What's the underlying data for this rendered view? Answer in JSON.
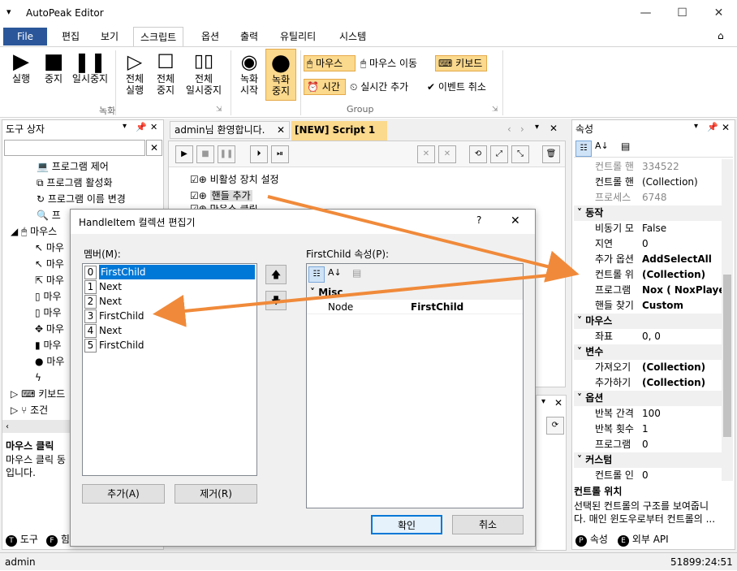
{
  "window": {
    "title": "AutoPeak Editor"
  },
  "menu": {
    "file": "File",
    "items": [
      "편집",
      "보기",
      "스크립트",
      "옵션",
      "출력",
      "유틸리티",
      "시스템"
    ]
  },
  "ribbon": {
    "run": "실행",
    "stop": "중지",
    "pause": "일시중지",
    "run_all_1": "전체",
    "run_all_2": "실행",
    "stop_all_1": "전체",
    "stop_all_2": "중지",
    "pause_all_1": "전체",
    "pause_all_2": "일시중지",
    "rec_start_1": "녹화",
    "rec_start_2": "시작",
    "rec_stop_1": "녹화",
    "rec_stop_2": "중지",
    "mouse": "마우스",
    "mouse_move": "마우스 이동",
    "keyboard": "키보드",
    "time": "시간",
    "realtime_add": "실시간 추가",
    "event_cancel": "이벤트 취소",
    "group_record": "녹화",
    "group_group": "Group"
  },
  "toolbox": {
    "title": "도구 상자",
    "items": [
      "프로그램 제어",
      "프로그램 활성화",
      "프로그램 이름 변경",
      "프",
      "마우스"
    ],
    "mouse_subs": [
      "마우",
      "마우",
      "마우",
      "마우",
      "마우",
      "마우",
      "마우",
      "마우"
    ],
    "keyboard": "키보드",
    "condition": "조건",
    "desc_title": "마우스 클릭",
    "desc_1": "마우스 클릭 동",
    "desc_2": "입니다.",
    "tab_tools": "도구",
    "tab_other": "힘"
  },
  "tabs": {
    "welcome": "admin님 환영합니다.",
    "script": "[NEW] Script 1"
  },
  "script_items": [
    "비활성 장치 설정",
    "핸들 추가",
    "마우스 클릭"
  ],
  "properties": {
    "title": "속성",
    "rows": [
      {
        "k": "컨트롤 핸",
        "v": "334522",
        "dim": true
      },
      {
        "k": "컨트롤 핸",
        "v": "(Collection)"
      },
      {
        "k": "프로세스",
        "v": "6748",
        "dim": true
      }
    ],
    "cat_action": "동작",
    "action_rows": [
      {
        "k": "비동기 모",
        "v": "False"
      },
      {
        "k": "지연",
        "v": "0"
      },
      {
        "k": "추가 옵션",
        "v": "AddSelectAll",
        "bold": true
      },
      {
        "k": "컨트롤 위",
        "v": "(Collection)",
        "bold": true
      },
      {
        "k": "프로그램",
        "v": "Nox ( NoxPlayer",
        "bold": true
      },
      {
        "k": "핸들 찾기",
        "v": "Custom",
        "bold": true
      }
    ],
    "cat_mouse": "마우스",
    "mouse_rows": [
      {
        "k": "좌표",
        "v": "0, 0"
      }
    ],
    "cat_var": "변수",
    "var_rows": [
      {
        "k": "가져오기",
        "v": "(Collection)",
        "bold": true
      },
      {
        "k": "추가하기",
        "v": "(Collection)",
        "bold": true
      }
    ],
    "cat_opt": "옵션",
    "opt_rows": [
      {
        "k": "반복 간격",
        "v": "100"
      },
      {
        "k": "반복 횟수",
        "v": "1"
      },
      {
        "k": "프로그램",
        "v": "0"
      }
    ],
    "cat_custom": "커스텀",
    "custom_rows": [
      {
        "k": "컨트롤 인",
        "v": "0"
      }
    ],
    "desc_title": "컨트롤 위치",
    "desc_1": "선택된 컨트롤의 구조를 보여줍니",
    "desc_2": "다. 매인 윈도우로부터 컨트롤의 ...",
    "tab_props": "속성",
    "tab_api": "외부 API"
  },
  "dialog": {
    "title": "HandleItem 컬렉션 편집기",
    "help": "?",
    "members_label": "멤버(M):",
    "members": [
      {
        "i": "0",
        "n": "FirstChild"
      },
      {
        "i": "1",
        "n": "Next"
      },
      {
        "i": "2",
        "n": "Next"
      },
      {
        "i": "3",
        "n": "FirstChild"
      },
      {
        "i": "4",
        "n": "Next"
      },
      {
        "i": "5",
        "n": "FirstChild"
      }
    ],
    "props_label": "FirstChild 속성(P):",
    "cat_misc": "Misc",
    "prop_key": "Node",
    "prop_val": "FirstChild",
    "add": "추가(A)",
    "remove": "제거(R)",
    "ok": "확인",
    "cancel": "취소"
  },
  "status": {
    "user": "admin",
    "time": "51899:24:51"
  },
  "colors": {
    "accent": "#2b579a",
    "highlight": "#fbd98d",
    "arrow": "#f08a3a",
    "selection": "#0078d7"
  }
}
